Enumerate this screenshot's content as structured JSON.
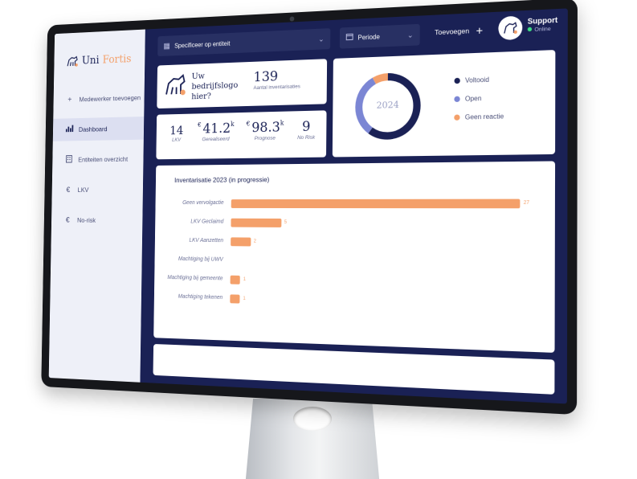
{
  "app": {
    "logo_part1": "Uni",
    "logo_part2": "Fortis"
  },
  "sidebar": {
    "items": [
      {
        "label": "Medewerker toevoegen",
        "icon": "plus-icon"
      },
      {
        "label": "Dashboard",
        "icon": "bar-chart-icon",
        "active": true
      },
      {
        "label": "Entiteiten overzicht",
        "icon": "building-icon"
      },
      {
        "label": "LKV",
        "icon": "euro-icon"
      },
      {
        "label": "No-risk",
        "icon": "euro-icon"
      }
    ]
  },
  "topbar": {
    "entity_select": "Specificeer op entiteit",
    "period_select": "Periode",
    "add_label": "Toevoegen",
    "user_name": "Support",
    "user_status": "Online"
  },
  "company_card": {
    "logo_text_1": "Uw",
    "logo_text_2": "bedrijfslogo",
    "logo_text_3": "hier?",
    "count": "139",
    "count_label": "Aantal inventarisaties"
  },
  "stats": [
    {
      "value": "14",
      "prefix": "",
      "suffix": "",
      "label": "LKV"
    },
    {
      "value": "41.2",
      "prefix": "€",
      "suffix": "k",
      "label": "Gerealiseerd"
    },
    {
      "value": "98.3",
      "prefix": "€",
      "suffix": "k",
      "label": "Prognose"
    },
    {
      "value": "9",
      "prefix": "",
      "suffix": "",
      "label": "No Risk"
    }
  ],
  "donut": {
    "center_label": "2024",
    "legend": [
      {
        "label": "Voltooid",
        "color": "#1a2155",
        "share": 0.6
      },
      {
        "label": "Open",
        "color": "#7b86d4",
        "share": 0.32
      },
      {
        "label": "Geen reactie",
        "color": "#f4a06a",
        "share": 0.08
      }
    ]
  },
  "chart_data": {
    "type": "bar",
    "title": "Inventarisatie 2023 (in progressie)",
    "categories": [
      "Geen vervolgactie",
      "LKV Geclaimd",
      "LKV Aanzetten",
      "Machtiging bij UWV",
      "Machtiging bij gemeente",
      "Machtiging tekenen"
    ],
    "values": [
      27,
      5,
      2,
      0,
      1,
      1
    ],
    "value_labels": [
      "27",
      "5",
      "2",
      "",
      "1",
      "1"
    ],
    "color": "#f4a06a",
    "orientation": "horizontal"
  }
}
